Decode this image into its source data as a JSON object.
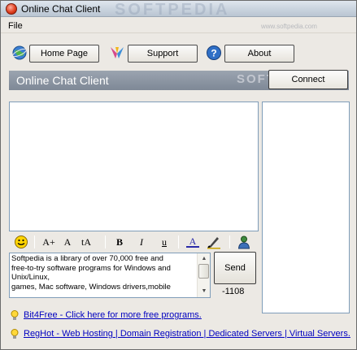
{
  "window": {
    "title": "Online Chat Client",
    "title_watermark": "SOFTPEDIA"
  },
  "menu": {
    "file": "File"
  },
  "nav": {
    "home_page": "Home Page",
    "support": "Support",
    "about": "About"
  },
  "header": {
    "title": "Online Chat Client",
    "watermark": "SOFTPEDIA",
    "watermark_sub": "www.softpedia.com",
    "connect": "Connect"
  },
  "toolbar": {
    "grow_font": "A+",
    "font": "A",
    "shrink_font": "tA",
    "bold": "B",
    "italic": "I",
    "underline": "u",
    "color": "A"
  },
  "input": {
    "text": "Softpedia is a library of over 70,000 free and\nfree-to-try software programs for Windows and\nUnix/Linux,\ngames, Mac software, Windows drivers,mobile"
  },
  "send": {
    "label": "Send",
    "char_count": "-1108"
  },
  "links": [
    {
      "text": "Bit4Free - Click here for more free programs."
    },
    {
      "text": "RegHot - Web Hosting | Domain Registration | Dedicated Servers | Virtual Servers."
    }
  ],
  "colors": {
    "accent_header": "#8a93a0",
    "link": "#0000c0"
  }
}
